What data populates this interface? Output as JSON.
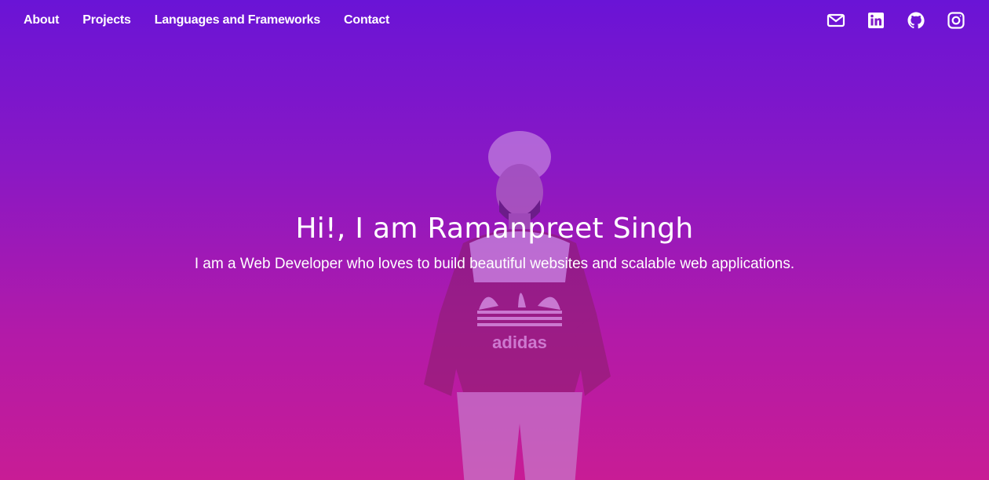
{
  "nav": {
    "links": [
      {
        "label": "About"
      },
      {
        "label": "Projects"
      },
      {
        "label": "Languages and Frameworks"
      },
      {
        "label": "Contact"
      }
    ],
    "social": [
      {
        "icon": "mail-icon"
      },
      {
        "icon": "linkedin-icon"
      },
      {
        "icon": "github-icon"
      },
      {
        "icon": "instagram-icon"
      }
    ]
  },
  "hero": {
    "title": "Hi!, I am Ramanpreet Singh",
    "subtitle": "I am a Web Developer who loves to build beautiful websites and scalable web applications.",
    "photo_logo_text": "adidas"
  },
  "colors": {
    "gradient_top": "#6a14d6",
    "gradient_bottom": "#c81c95",
    "text": "#ffffff"
  }
}
